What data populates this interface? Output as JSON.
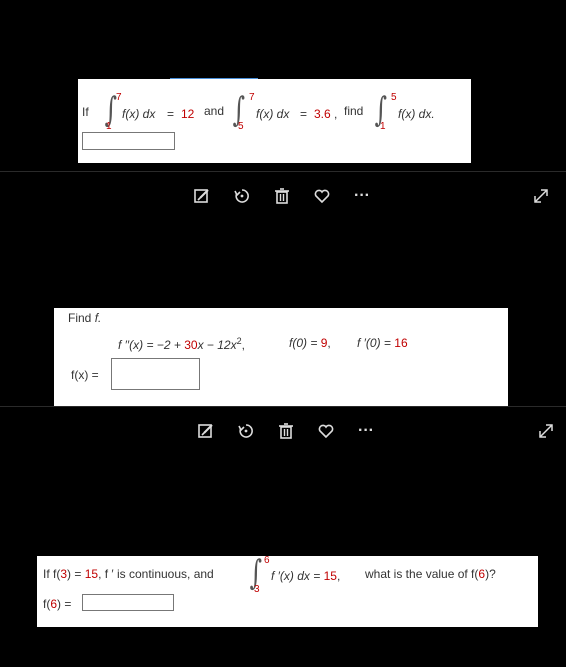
{
  "problem1": {
    "if": "If",
    "int1": {
      "upper": "7",
      "lower": "1",
      "integrand": "f(x) dx",
      "eq": "=",
      "value": "12"
    },
    "and": "and",
    "int2": {
      "upper": "7",
      "lower": "5",
      "integrand": "f(x) dx",
      "eq": "=",
      "value": "3.6",
      "comma": ","
    },
    "find": "find",
    "int3": {
      "upper": "5",
      "lower": "1",
      "integrand": "f(x) dx."
    }
  },
  "toolbar_icons": [
    "edit-icon",
    "rotate-icon",
    "trash-icon",
    "heart-icon",
    "more-icon",
    "expand-icon"
  ],
  "more_label": "···",
  "problem2": {
    "heading": "Find",
    "heading_f": "f.",
    "eq_pre": "f ′′(x) = −2 + ",
    "eq_30": "30",
    "eq_mid": "x − 12x",
    "eq_sup": "2",
    "eq_comma": ",",
    "f0_label": "f(0) = ",
    "f0_val": "9",
    "fp0_label": "f ′(0) = ",
    "fp0_val": "16",
    "answer_label": "f(x) ="
  },
  "problem3": {
    "pre": "If f(",
    "three": "3",
    "mid1": ") = ",
    "fifteen1": "15",
    "mid2": ", f ′ is continuous, and",
    "int": {
      "upper": "6",
      "lower": "3",
      "integrand": "f ′(x) dx = ",
      "value": "15",
      "comma": ","
    },
    "question_pre": "what is the value of f(",
    "six": "6",
    "question_post": ")?",
    "answer_label_pre": "f(",
    "answer_six": "6",
    "answer_label_post": ") ="
  },
  "colors": {
    "accent_red": "#c00000",
    "background": "#000000",
    "card": "#ffffff"
  }
}
